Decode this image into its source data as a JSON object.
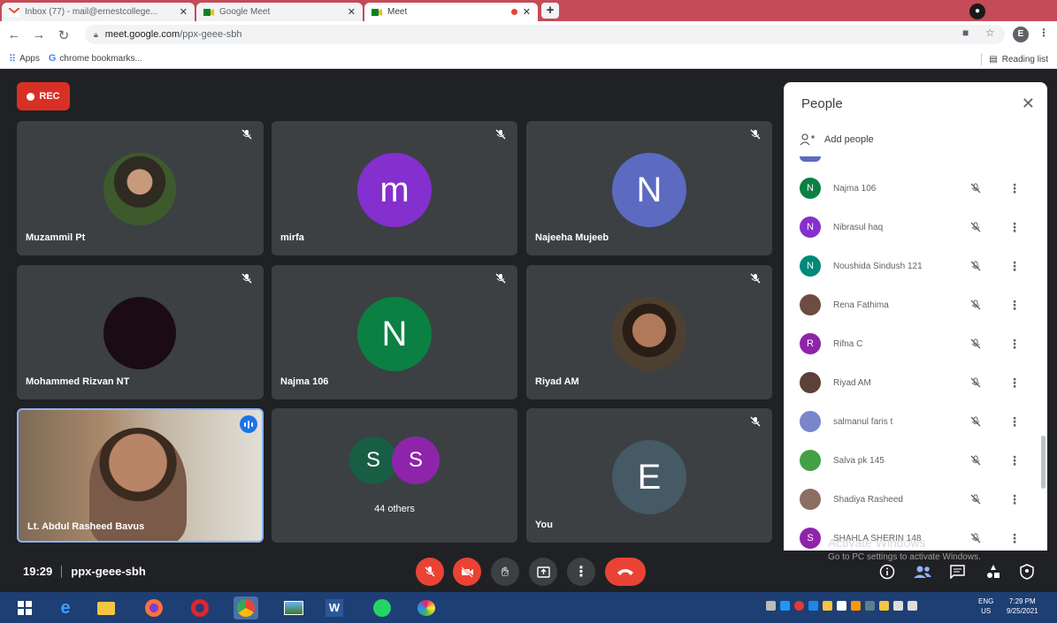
{
  "browser": {
    "tabs": [
      {
        "title": "Inbox (77) - mail@ernestcollege...",
        "icon": "gmail-icon"
      },
      {
        "title": "Google Meet",
        "icon": "meet-icon"
      },
      {
        "title": "Meet",
        "icon": "meet-icon"
      }
    ],
    "url_host": "meet.google.com",
    "url_path": "/ppx-geee-sbh",
    "account_initial": "E",
    "bookmarks": [
      {
        "label": "Apps",
        "icon": "apps-grid-icon"
      },
      {
        "label": "chrome bookmarks...",
        "icon": "google-g-icon"
      }
    ],
    "reading_list": "Reading list"
  },
  "meet": {
    "rec_label": "REC",
    "tiles": [
      {
        "name": "Muzammil Pt",
        "type": "photo",
        "muted": true
      },
      {
        "name": "mirfa",
        "initial": "m",
        "color": "#8430ce",
        "muted": true
      },
      {
        "name": "Najeeha Mujeeb",
        "initial": "N",
        "color": "#5c6bc0",
        "muted": true
      },
      {
        "name": "Mohammed Rizvan NT",
        "type": "dark",
        "muted": true
      },
      {
        "name": "Najma 106",
        "initial": "N",
        "color": "#0b8043",
        "muted": true
      },
      {
        "name": "Riyad AM",
        "type": "photo",
        "muted": true
      },
      {
        "name": "Lt. Abdul Rasheed Bavus",
        "type": "video",
        "speaking": true
      },
      {
        "others_label": "44 others",
        "initials": [
          "S",
          "S"
        ],
        "colors": [
          "#185e45",
          "#8e24aa"
        ]
      },
      {
        "name": "You",
        "initial": "E",
        "color": "#455a64",
        "muted": true
      }
    ],
    "meeting_time": "19:29",
    "meeting_code": "ppx-geee-sbh",
    "colors": {
      "end_call": "#ea4335",
      "self_border": "#8ab4f8"
    }
  },
  "people_panel": {
    "title": "People",
    "add_people": "Add people",
    "participants": [
      {
        "name": "Najma 106",
        "initial": "N",
        "color": "#0b8043"
      },
      {
        "name": "Nibrasul haq",
        "initial": "N",
        "color": "#8430ce"
      },
      {
        "name": "Noushida Sindush 121",
        "initial": "N",
        "color": "#00897b"
      },
      {
        "name": "Rena Fathima",
        "initial": "",
        "color": "#6d4c41"
      },
      {
        "name": "Rifna C",
        "initial": "R",
        "color": "#8e24aa"
      },
      {
        "name": "Riyad AM",
        "initial": "",
        "color": "#5d4037"
      },
      {
        "name": "salmanul faris t",
        "initial": "",
        "color": "#7986cb"
      },
      {
        "name": "Salva pk 145",
        "initial": "",
        "color": "#43a047"
      },
      {
        "name": "Shadiya Rasheed",
        "initial": "",
        "color": "#8d6e63"
      },
      {
        "name": "SHAHLA SHERIN 148",
        "initial": "S",
        "color": "#8e24aa"
      }
    ]
  },
  "windows": {
    "watermark_title": "Activate Windows",
    "watermark_sub": "Go to PC settings to activate Windows.",
    "lang_line1": "ENG",
    "lang_line2": "US",
    "time": "7:29 PM",
    "date": "9/25/2021"
  }
}
